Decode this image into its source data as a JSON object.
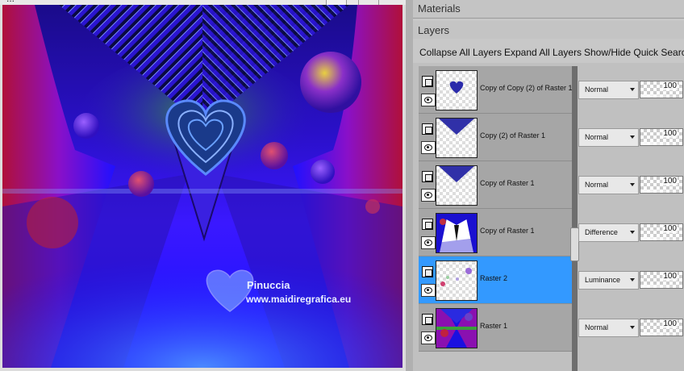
{
  "image_window": {
    "title": "...",
    "watermark_name": "Pinuccia",
    "watermark_url": "www.maidiregrafica.eu"
  },
  "panels": {
    "materials_label": "Materials",
    "layers_label": "Layers"
  },
  "toolbar": {
    "collapse": "Collapse All Layers",
    "expand": "Expand All Layers",
    "showhide": "Show/Hide Quick Search"
  },
  "layers": [
    {
      "name": "Copy of Copy (2) of Raster 1",
      "blend": "Normal",
      "opacity": "100",
      "selected": false,
      "thumb": "heart"
    },
    {
      "name": "Copy (2) of Raster 1",
      "blend": "Normal",
      "opacity": "100",
      "selected": false,
      "thumb": "triangle"
    },
    {
      "name": "Copy of Raster 1",
      "blend": "Normal",
      "opacity": "100",
      "selected": false,
      "thumb": "triangle"
    },
    {
      "name": "Copy of Raster 1",
      "blend": "Difference",
      "opacity": "100",
      "selected": false,
      "thumb": "difference"
    },
    {
      "name": "Raster 2",
      "blend": "Luminance",
      "opacity": "100",
      "selected": true,
      "thumb": "spheres"
    },
    {
      "name": "Raster 1",
      "blend": "Normal",
      "opacity": "100",
      "selected": false,
      "thumb": "full"
    }
  ],
  "colors": {
    "selection": "#3399ff",
    "canvas_blue": "#1e10ff",
    "canvas_purple": "#6a10c8",
    "canvas_red": "#b0103a",
    "canvas_green": "#1a8a3a"
  }
}
